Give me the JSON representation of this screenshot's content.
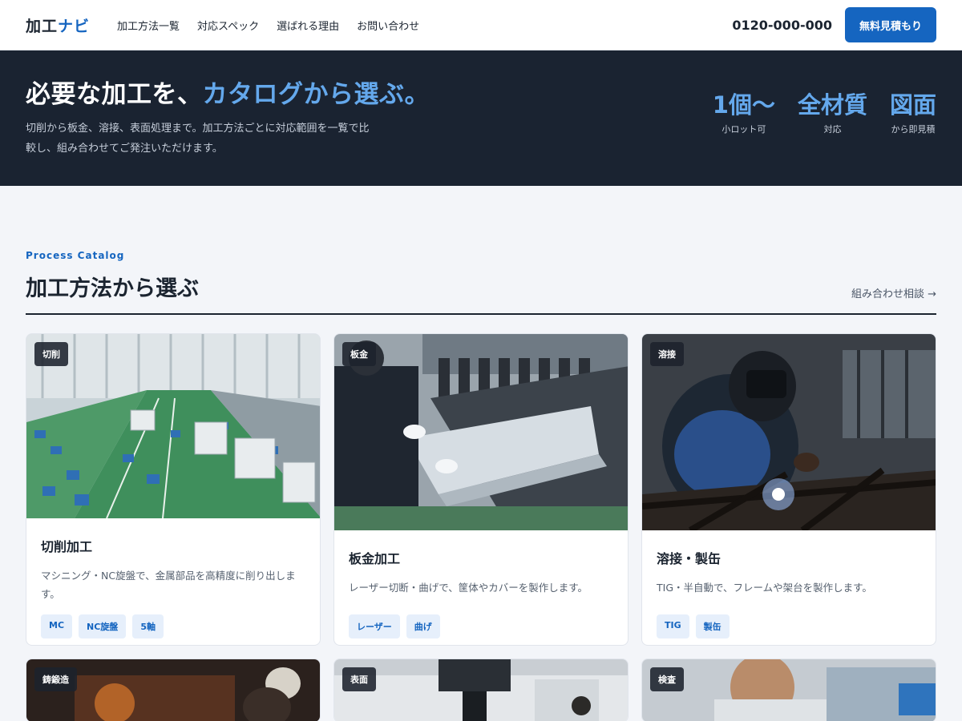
{
  "header": {
    "logo_main": "加工",
    "logo_accent": "ナビ",
    "nav": [
      "加工方法一覧",
      "対応スペック",
      "選ばれる理由",
      "お問い合わせ"
    ],
    "phone": "0120-000-000",
    "cta_label": "無料見積もり"
  },
  "hero": {
    "title_main": "必要な加工を、",
    "title_accent": "カタログから選ぶ。",
    "lead": "切削から板金、溶接、表面処理まで。加工方法ごとに対応範囲を一覧で比較し、組み合わせてご発注いただけます。",
    "stats": [
      {
        "value": "1個〜",
        "label": "小ロット可"
      },
      {
        "value": "全材質",
        "label": "対応"
      },
      {
        "value": "図面",
        "label": "から即見積"
      }
    ]
  },
  "catalog": {
    "eyebrow": "Process Catalog",
    "title": "加工方法から選ぶ",
    "combo_link": "組み合わせ相談 →",
    "cards": [
      {
        "tag": "切削",
        "title": "切削加工",
        "desc": "マシニング・NC旋盤で、金属部品を高精度に削り出します。",
        "chips": [
          "MC",
          "NC旋盤",
          "5軸"
        ]
      },
      {
        "tag": "板金",
        "title": "板金加工",
        "desc": "レーザー切断・曲げで、筐体やカバーを製作します。",
        "chips": [
          "レーザー",
          "曲げ"
        ]
      },
      {
        "tag": "溶接",
        "title": "溶接・製缶",
        "desc": "TIG・半自動で、フレームや架台を製作します。",
        "chips": [
          "TIG",
          "製缶"
        ]
      },
      {
        "tag": "鋳鍛造"
      },
      {
        "tag": "表面"
      },
      {
        "tag": "検査"
      }
    ]
  }
}
